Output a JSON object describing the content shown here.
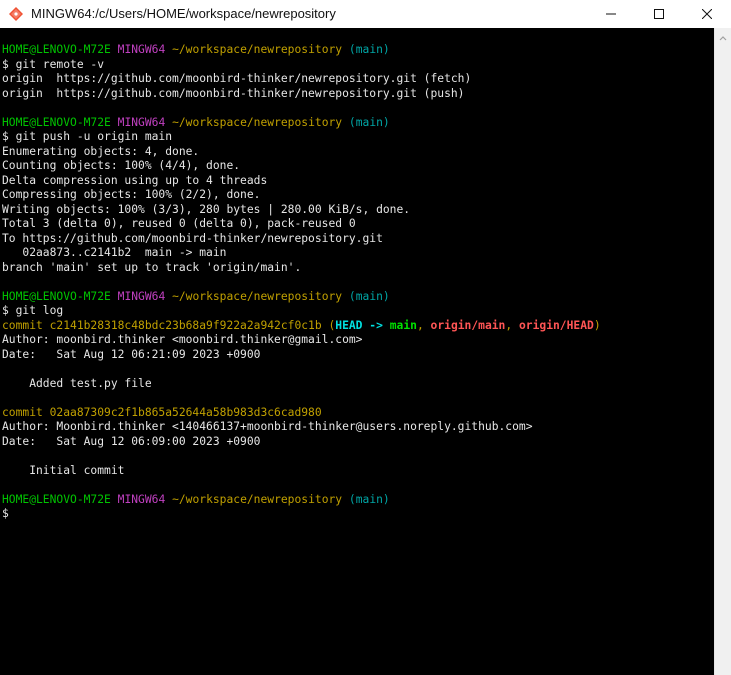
{
  "window": {
    "title": "MINGW64:/c/Users/HOME/workspace/newrepository"
  },
  "icons": {
    "app": "git-bash-icon",
    "minimize": "minimize-icon",
    "maximize": "maximize-icon",
    "close": "close-icon",
    "scroll_up": "scroll-up-arrow-icon"
  },
  "colors": {
    "prompt_user": "#00c400",
    "prompt_msystem": "#c040c0",
    "prompt_path": "#c0a000",
    "prompt_branch": "#00a6a6",
    "commit_hash": "#c0a000",
    "ref_head": "#00e0e0",
    "ref_main": "#00e000",
    "ref_remote": "#ff5555",
    "terminal_bg": "#000000",
    "terminal_fg": "#e6e6e6"
  },
  "prompt": {
    "user_host": "HOME@LENOVO-M72E",
    "msystem": "MINGW64",
    "path": "~/workspace/newrepository",
    "branch": "(main)"
  },
  "session": {
    "cmd1": "$ git remote -v",
    "remote_fetch": "origin  https://github.com/moonbird-thinker/newrepository.git (fetch)",
    "remote_push": "origin  https://github.com/moonbird-thinker/newrepository.git (push)",
    "cmd2": "$ git push -u origin main",
    "push_out": [
      "Enumerating objects: 4, done.",
      "Counting objects: 100% (4/4), done.",
      "Delta compression using up to 4 threads",
      "Compressing objects: 100% (2/2), done.",
      "Writing objects: 100% (3/3), 280 bytes | 280.00 KiB/s, done.",
      "Total 3 (delta 0), reused 0 (delta 0), pack-reused 0",
      "To https://github.com/moonbird-thinker/newrepository.git",
      "   02aa873..c2141b2  main -> main",
      "branch 'main' set up to track 'origin/main'."
    ],
    "cmd3": "$ git log",
    "commit1": {
      "hash": "commit c2141b28318c48bdc23b68a9f922a2a942cf0c1b",
      "refs_open": " (",
      "ref_head": "HEAD",
      "ref_arrow": " -> ",
      "ref_main": "main",
      "sep1": ", ",
      "ref_origin_main": "origin/main",
      "sep2": ", ",
      "ref_origin_head": "origin/HEAD",
      "refs_close": ")",
      "author": "Author: moonbird.thinker <moonbird.thinker@gmail.com>",
      "date": "Date:   Sat Aug 12 06:21:09 2023 +0900",
      "message": "    Added test.py file"
    },
    "commit2": {
      "hash": "commit 02aa87309c2f1b865a52644a58b983d3c6cad980",
      "author": "Author: Moonbird.thinker <140466137+moonbird-thinker@users.noreply.github.com>",
      "date": "Date:   Sat Aug 12 06:09:00 2023 +0900",
      "message": "    Initial commit"
    },
    "final_prompt": "$"
  }
}
